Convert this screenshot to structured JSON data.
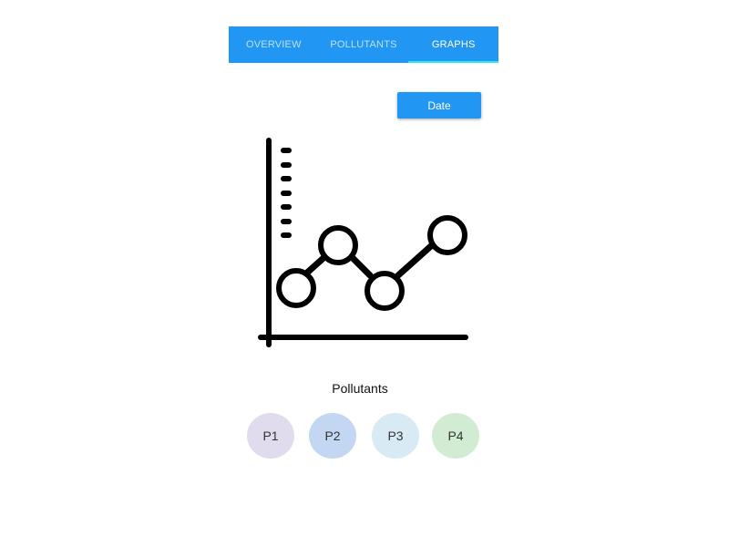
{
  "tabs": [
    {
      "label": "OVERVIEW",
      "active": false
    },
    {
      "label": "POLLUTANTS",
      "active": false
    },
    {
      "label": "GRAPHS",
      "active": true
    }
  ],
  "colors": {
    "primary": "#2196f3",
    "tab_indicator": "#31e8f2",
    "chip_p1": "#e0dced",
    "chip_p2": "#c3d6f2",
    "chip_p3": "#d8eaf3",
    "chip_p4": "#d2ecd4"
  },
  "date_button": {
    "label": "Date"
  },
  "illustration": {
    "icon": "line-graph-icon"
  },
  "pollutants": {
    "heading": "Pollutants",
    "chips": [
      {
        "label": "P1",
        "color": "#e0dced"
      },
      {
        "label": "P2",
        "color": "#c3d6f2"
      },
      {
        "label": "P3",
        "color": "#d8eaf3"
      },
      {
        "label": "P4",
        "color": "#d2ecd4"
      }
    ]
  }
}
